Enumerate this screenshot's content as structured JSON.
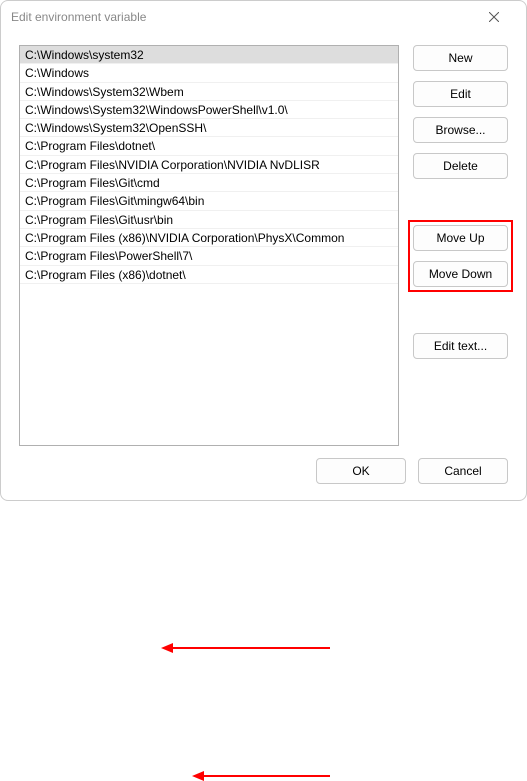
{
  "window": {
    "title": "Edit environment variable"
  },
  "list": {
    "selected_index": 0,
    "items": [
      "C:\\Windows\\system32",
      "C:\\Windows",
      "C:\\Windows\\System32\\Wbem",
      "C:\\Windows\\System32\\WindowsPowerShell\\v1.0\\",
      "C:\\Windows\\System32\\OpenSSH\\",
      "C:\\Program Files\\dotnet\\",
      "C:\\Program Files\\NVIDIA Corporation\\NVIDIA NvDLISR",
      "C:\\Program Files\\Git\\cmd",
      "C:\\Program Files\\Git\\mingw64\\bin",
      "C:\\Program Files\\Git\\usr\\bin",
      "C:\\Program Files (x86)\\NVIDIA Corporation\\PhysX\\Common",
      "C:\\Program Files\\PowerShell\\7\\",
      "C:\\Program Files (x86)\\dotnet\\"
    ]
  },
  "buttons": {
    "new": "New",
    "edit": "Edit",
    "browse": "Browse...",
    "delete": "Delete",
    "move_up": "Move Up",
    "move_down": "Move Down",
    "edit_text": "Edit text...",
    "ok": "OK",
    "cancel": "Cancel"
  },
  "annotations": {
    "highlight_buttons": [
      "move_up",
      "move_down"
    ],
    "arrows_to_items": [
      5,
      12
    ]
  }
}
